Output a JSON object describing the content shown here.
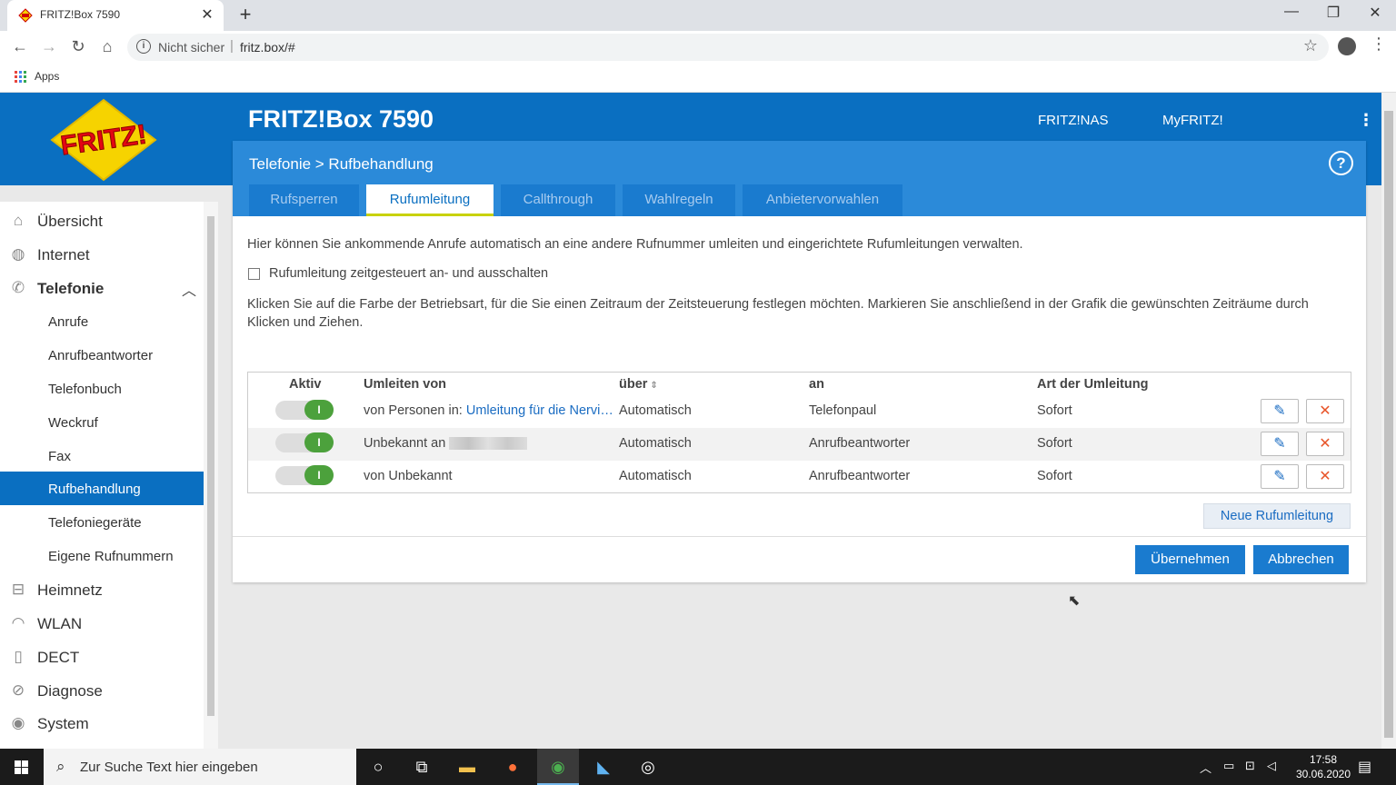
{
  "browser": {
    "tab_title": "FRITZ!Box 7590",
    "tab_close": "✕",
    "new_tab": "+",
    "security_label": "Nicht sicher",
    "separator": "|",
    "url": "fritz.box/#",
    "bookmarks": {
      "apps_label": "Apps"
    }
  },
  "header": {
    "title": "FRITZ!Box 7590",
    "links": [
      "FRITZ!NAS",
      "MyFRITZ!"
    ],
    "menu_icon": "⋮"
  },
  "sidebar": {
    "items": [
      {
        "label": "Übersicht",
        "icon": "home-icon"
      },
      {
        "label": "Internet",
        "icon": "globe-icon"
      },
      {
        "label": "Telefonie",
        "icon": "phone-icon",
        "expanded": true
      },
      {
        "label": "Anrufe"
      },
      {
        "label": "Anrufbeantworter"
      },
      {
        "label": "Telefonbuch"
      },
      {
        "label": "Weckruf"
      },
      {
        "label": "Fax"
      },
      {
        "label": "Rufbehandlung",
        "active": true
      },
      {
        "label": "Telefoniegeräte"
      },
      {
        "label": "Eigene Rufnummern"
      },
      {
        "label": "Heimnetz",
        "icon": "network-icon"
      },
      {
        "label": "WLAN",
        "icon": "wifi-icon"
      },
      {
        "label": "DECT",
        "icon": "dect-icon"
      },
      {
        "label": "Diagnose",
        "icon": "diagnose-icon"
      },
      {
        "label": "System",
        "icon": "system-icon"
      }
    ]
  },
  "main": {
    "breadcrumb": "Telefonie > Rufbehandlung",
    "help": "?",
    "tabs": [
      "Rufsperren",
      "Rufumleitung",
      "Callthrough",
      "Wahlregeln",
      "Anbietervorwahlen"
    ],
    "active_tab": "Rufumleitung",
    "intro": "Hier können Sie ankommende Anrufe automatisch an eine andere Rufnummer umleiten und eingerichtete Rufumleitungen verwalten.",
    "checkbox_label": "Rufumleitung zeitgesteuert an- und ausschalten",
    "checkbox_checked": false,
    "instructions": "Klicken Sie auf die Farbe der Betriebsart, für die Sie einen Zeitraum der Zeitsteuerung festlegen möchten. Markieren Sie anschließend in der Grafik die gewünschten Zeiträume durch Klicken und Ziehen.",
    "table": {
      "headers": [
        "Aktiv",
        "Umleiten von",
        "über",
        "an",
        "Art der Umleitung"
      ],
      "sort_icon": "sort-icon",
      "rows": [
        {
          "active": true,
          "toggle_label": "I",
          "from_prefix": "von Personen in: ",
          "from_link": "Umleitung für die Nervi…",
          "via": "Automatisch",
          "to": "Telefonpaul",
          "type": "Sofort"
        },
        {
          "active": true,
          "toggle_label": "I",
          "from_prefix": "Unbekannt an",
          "from_redacted": true,
          "via": "Automatisch",
          "to": "Anrufbeantworter",
          "type": "Sofort"
        },
        {
          "active": true,
          "toggle_label": "I",
          "from_prefix": "von Unbekannt",
          "via": "Automatisch",
          "to": "Anrufbeantworter",
          "type": "Sofort"
        }
      ]
    },
    "new_button": "Neue Rufumleitung",
    "apply_button": "Übernehmen",
    "cancel_button": "Abbrechen"
  },
  "taskbar": {
    "search_placeholder": "Zur Suche Text hier eingeben",
    "time": "17:58",
    "date": "30.06.2020"
  },
  "colors": {
    "header_blue": "#0a6fc1",
    "crumb_blue": "#2b8ad9",
    "tab_underline": "#c8d20a",
    "toggle_green": "#4ca13c",
    "delete_orange": "#e8552a"
  }
}
